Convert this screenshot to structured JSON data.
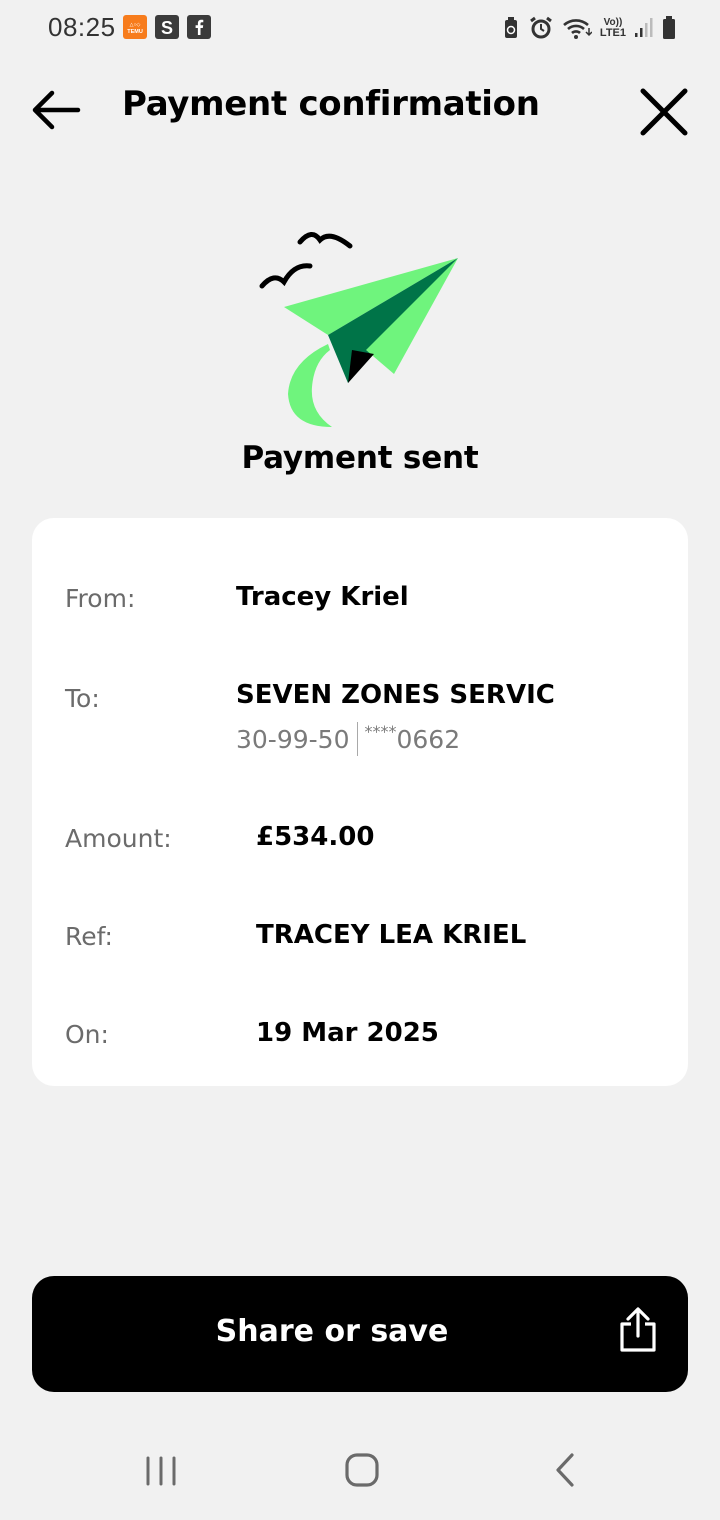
{
  "status_bar": {
    "time": "08:25",
    "app_icons": [
      "temu-icon",
      "s-app-icon",
      "facebook-icon"
    ],
    "right_icons": [
      "recycle-icon",
      "alarm-icon",
      "wifi-icon",
      "volte-lte-icon",
      "signal-icon",
      "battery-icon"
    ],
    "network_top": "Vo))",
    "network_bottom": "LTE1"
  },
  "header": {
    "title": "Payment confirmation",
    "back_icon": "arrow-left-icon",
    "close_icon": "close-icon"
  },
  "illustration": {
    "icon": "paper-plane-icon",
    "colors": {
      "light_green": "#6ff47d",
      "dark_green": "#007448",
      "black": "#000000"
    }
  },
  "status_heading": "Payment sent",
  "details": {
    "from": {
      "label": "From:",
      "value": "Tracey Kriel"
    },
    "to": {
      "label": "To:",
      "value": "SEVEN ZONES SERVIC",
      "sort_code": "30-99-50",
      "account_mask": "****",
      "account_end": "0662"
    },
    "amount": {
      "label": "Amount:",
      "value": "£534.00"
    },
    "ref": {
      "label": "Ref:",
      "value": "TRACEY LEA KRIEL"
    },
    "on": {
      "label": "On:",
      "value": "19 Mar 2025"
    }
  },
  "share": {
    "label": "Share or save",
    "icon": "share-icon"
  },
  "nav": {
    "recents_icon": "recents-icon",
    "home_icon": "home-icon",
    "back_icon": "nav-back-icon"
  }
}
